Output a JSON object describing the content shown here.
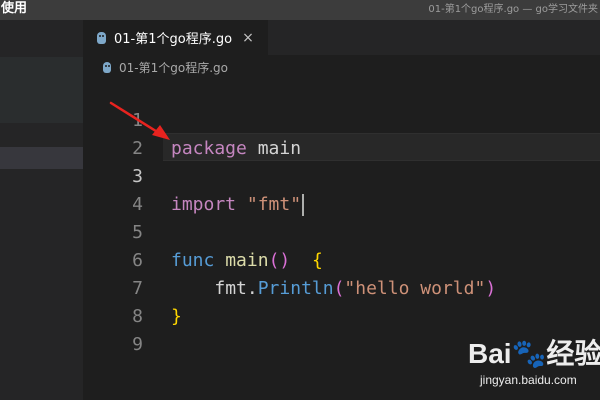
{
  "titlebar": {
    "app_label": "使用",
    "window_title": "01-第1个go程序.go — go学习文件夹"
  },
  "tab": {
    "label": "01-第1个go程序.go",
    "close_glyph": "×",
    "icon": "go-file-icon"
  },
  "breadcrumb": {
    "label": "01-第1个go程序.go",
    "icon": "go-file-icon"
  },
  "editor": {
    "active_line": 3,
    "lines": [
      {
        "n": "1",
        "tokens": {
          "a": "package",
          "b": " main"
        }
      },
      {
        "n": "2"
      },
      {
        "n": "3",
        "tokens": {
          "a": "import",
          "b": " ",
          "c": "\"fmt\""
        }
      },
      {
        "n": "4"
      },
      {
        "n": "5",
        "tokens": {
          "a": "func",
          "b": " ",
          "c": "main",
          "d": "()",
          "e": "  ",
          "f": "{"
        }
      },
      {
        "n": "6",
        "tokens": {
          "a": "    ",
          "b": "fmt",
          "c": ".",
          "d": "Println",
          "e": "(",
          "f": "\"hello world\"",
          "g": ")"
        }
      },
      {
        "n": "7",
        "tokens": {
          "a": "}"
        }
      },
      {
        "n": "8"
      },
      {
        "n": "9"
      }
    ]
  },
  "annotation": {
    "type": "red-arrow",
    "color": "#e8231f"
  },
  "watermark": {
    "logo_text": "Bai🐾经验",
    "url": "jingyan.baidu.com"
  }
}
